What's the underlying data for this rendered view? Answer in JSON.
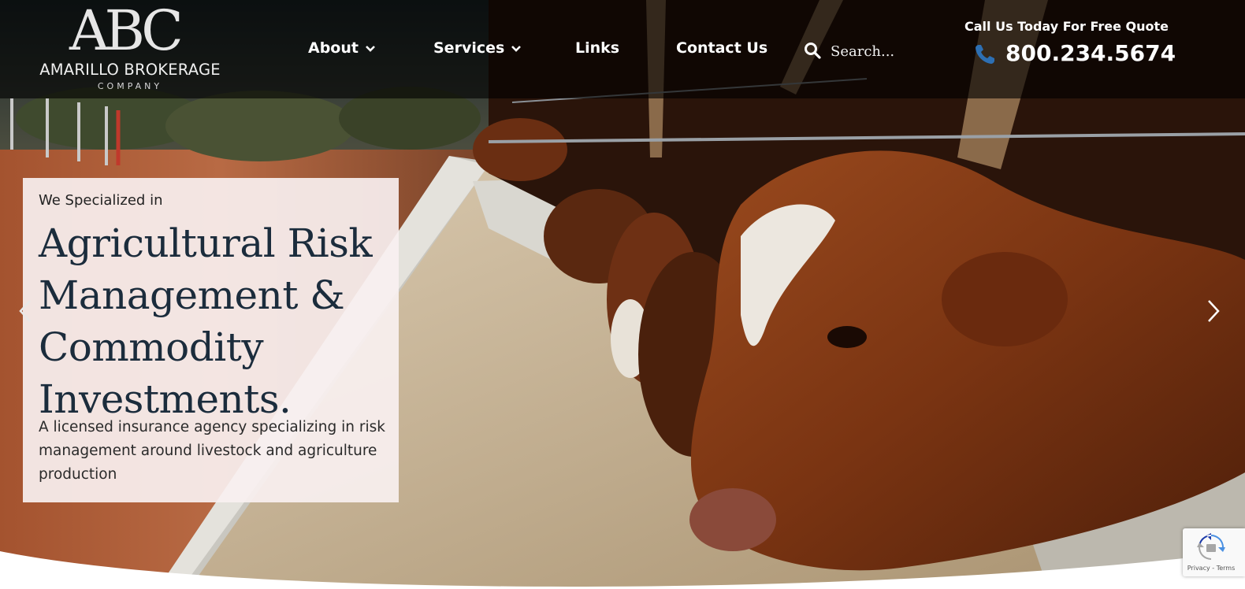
{
  "header": {
    "logo": {
      "mark": "ABC",
      "name": "AMARILLO BROKERAGE",
      "sub": "COMPANY"
    },
    "nav": [
      {
        "label": "About",
        "dropdown": true
      },
      {
        "label": "Services",
        "dropdown": true
      },
      {
        "label": "Links",
        "dropdown": false
      },
      {
        "label": "Contact Us",
        "dropdown": false
      }
    ],
    "search": {
      "placeholder": "Search...",
      "icon": "search-icon"
    },
    "quote_label": "Call Us Today For Free Quote",
    "phone": "800.234.5674"
  },
  "hero": {
    "eyebrow": "We Specialized in",
    "headline_lines": [
      "Agricultural Risk",
      "Management &",
      "Commodity",
      "Investments."
    ],
    "description": "A licensed insurance agency specializing in risk management around livestock and agriculture production"
  },
  "carousel": {
    "prev_icon": "chevron-left-icon",
    "next_icon": "chevron-right-icon"
  },
  "recaptcha": {
    "links": "Privacy - Terms"
  },
  "colors": {
    "header_bg": "#000000",
    "headline": "#1b2c3c",
    "phone_icon": "#2d6fb3"
  }
}
